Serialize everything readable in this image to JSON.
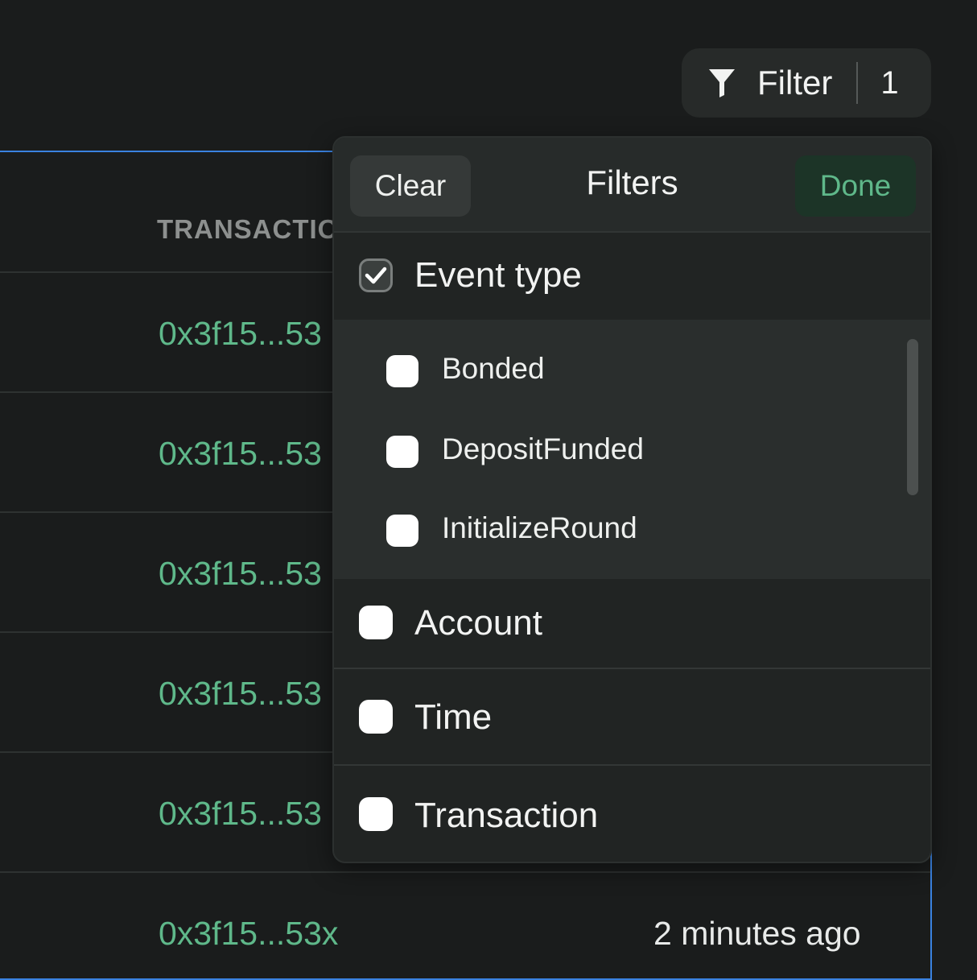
{
  "filter_button": {
    "label": "Filter",
    "count": "1"
  },
  "table": {
    "column_header": "TRANSACTIO",
    "rows": [
      {
        "hash": "0x3f15...53"
      },
      {
        "hash": "0x3f15...53"
      },
      {
        "hash": "0x3f15...53"
      },
      {
        "hash": "0x3f15...53"
      },
      {
        "hash": "0x3f15...53"
      }
    ],
    "last_row": {
      "hash": "0x3f15...53x",
      "time": "2 minutes ago"
    }
  },
  "popover": {
    "clear_label": "Clear",
    "title": "Filters",
    "done_label": "Done",
    "event_type": {
      "label": "Event type",
      "checked": true,
      "options": [
        {
          "label": "Bonded",
          "checked": false
        },
        {
          "label": "DepositFunded",
          "checked": false
        },
        {
          "label": "InitializeRound",
          "checked": false
        }
      ]
    },
    "account": {
      "label": "Account",
      "checked": false
    },
    "time": {
      "label": "Time",
      "checked": false
    },
    "transaction": {
      "label": "Transaction",
      "checked": false
    }
  },
  "colors": {
    "accent_green": "#5fb88a",
    "focus_blue": "#3a82e0",
    "background": "#1a1c1c"
  },
  "icons": [
    "filter-icon",
    "checkmark-icon"
  ]
}
